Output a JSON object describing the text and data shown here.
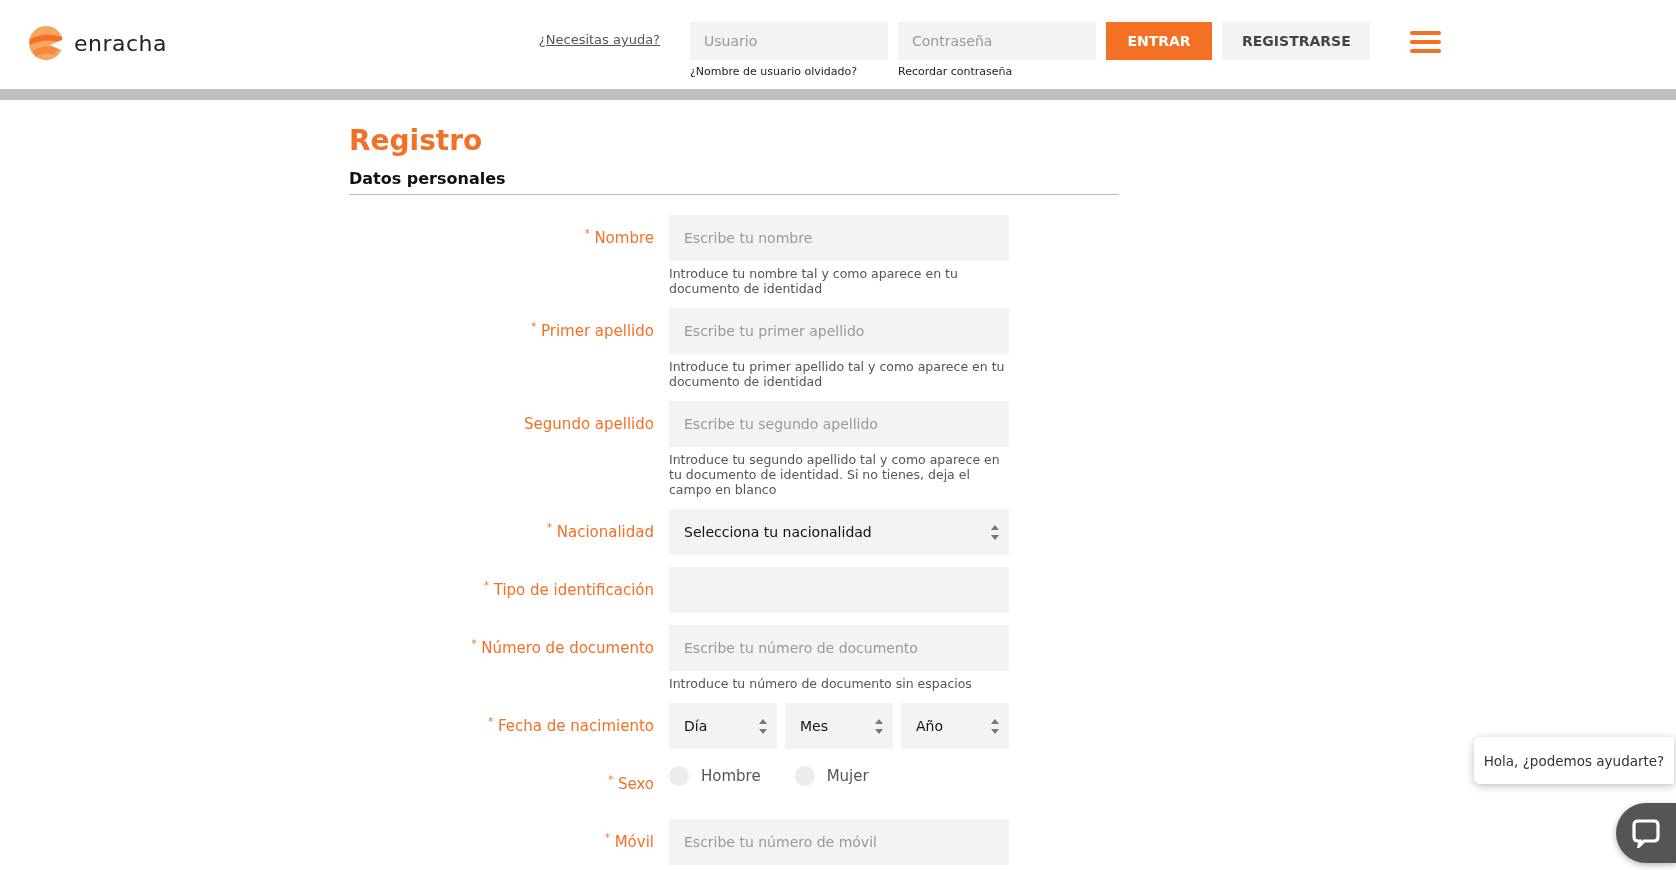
{
  "header": {
    "logo_text": "enracha",
    "help_link": "¿Necesitas ayuda?",
    "login": {
      "username": {
        "placeholder": "Usuario",
        "link": "¿Nombre de usuario olvidado?"
      },
      "password": {
        "placeholder": "Contraseña",
        "link": "Recordar contraseña"
      }
    },
    "buttons": [
      {
        "kind": "primary",
        "label": "ENTRAR"
      },
      {
        "kind": "secondary",
        "label": "REGISTRARSE"
      }
    ]
  },
  "page_title": "Registro",
  "section_title": "Datos personales",
  "fields": [
    {
      "kind": "text",
      "label": "$^{*}$ Nombre",
      "placeholder": "Escribe tu nombre",
      "help": "Introduce tu nombre tal y como aparece en tu documento de identidad"
    },
    {
      "kind": "text",
      "label": "$^{*}$ Primer apellido",
      "placeholder": "Escribe tu primer apellido",
      "help": "Introduce tu primer apellido tal y como aparece en tu documento de identidad"
    },
    {
      "kind": "text",
      "label": "Segundo apellido",
      "placeholder": "Escribe tu segundo apellido",
      "help": "Introduce tu segundo apellido tal y como aparece en tu documento de identidad. Si no tienes, deja el campo en blanco"
    },
    {
      "kind": "select",
      "label": "$^{*}$ Nacionalidad",
      "value": "Selecciona tu nacionalidad"
    },
    {
      "kind": "text",
      "label": "$^{*}$ Tipo de identificación"
    },
    {
      "kind": "text",
      "label": "$^{*}$ Número de documento",
      "placeholder": "Escribe tu número de documento",
      "help": "Introduce tu número de documento sin espacios"
    },
    {
      "kind": "date",
      "label": "$^{*}$ Fecha de nacimiento",
      "parts": [
        "Día",
        "Mes",
        "Año"
      ]
    },
    {
      "kind": "radio",
      "label": "$^{*}$ Sexo",
      "options": [
        {
          "label": "Hombre",
          "selected": false
        },
        {
          "label": "Mujer",
          "selected": false
        }
      ]
    },
    {
      "kind": "text",
      "label": "$^{*}$ Móvil",
      "placeholder": "Escribe tu número de móvil"
    }
  ],
  "chat": {
    "message": "Hola, ¿podemos ayudarte?"
  }
}
